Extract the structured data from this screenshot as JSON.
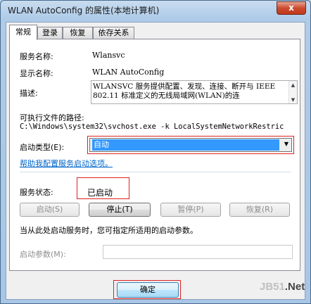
{
  "window": {
    "title": "WLAN AutoConfig 的属性(本地计算机)",
    "close_label": "x"
  },
  "tabs": [
    {
      "label": "常规",
      "active": true
    },
    {
      "label": "登录",
      "active": false
    },
    {
      "label": "恢复",
      "active": false
    },
    {
      "label": "依存关系",
      "active": false
    }
  ],
  "general": {
    "service_name_label": "服务名称:",
    "service_name": "Wlansvc",
    "display_name_label": "显示名称:",
    "display_name": "WLAN AutoConfig",
    "description_label": "描述:",
    "description": "WLANSVC 服务提供配置、发现、连接、断开与 IEEE 802.11 标准定义的无线局域网(WLAN)的连",
    "exe_path_label": "可执行文件的路径:",
    "exe_path": "C:\\Windows\\system32\\svchost.exe -k LocalSystemNetworkRestric",
    "startup_type_label": "启动类型(E):",
    "startup_type": "自动",
    "help_link": "帮助我配置服务启动选项。",
    "status_label": "服务状态:",
    "status": "已启动",
    "start_btn": "启动(S)",
    "stop_btn": "停止(T)",
    "pause_btn": "暂停(P)",
    "resume_btn": "恢复(R)",
    "hint": "当从此处启动服务时，您可指定所适用的启动参数。",
    "start_params_label": "启动参数(M):",
    "start_params_value": ""
  },
  "footer": {
    "ok_btn": "确定"
  },
  "watermark": {
    "prefix": "JB51",
    "suffix": ".Net"
  },
  "colors": {
    "highlight_box": "#e02020",
    "selection": "#3399ff",
    "link": "#0066cc"
  }
}
